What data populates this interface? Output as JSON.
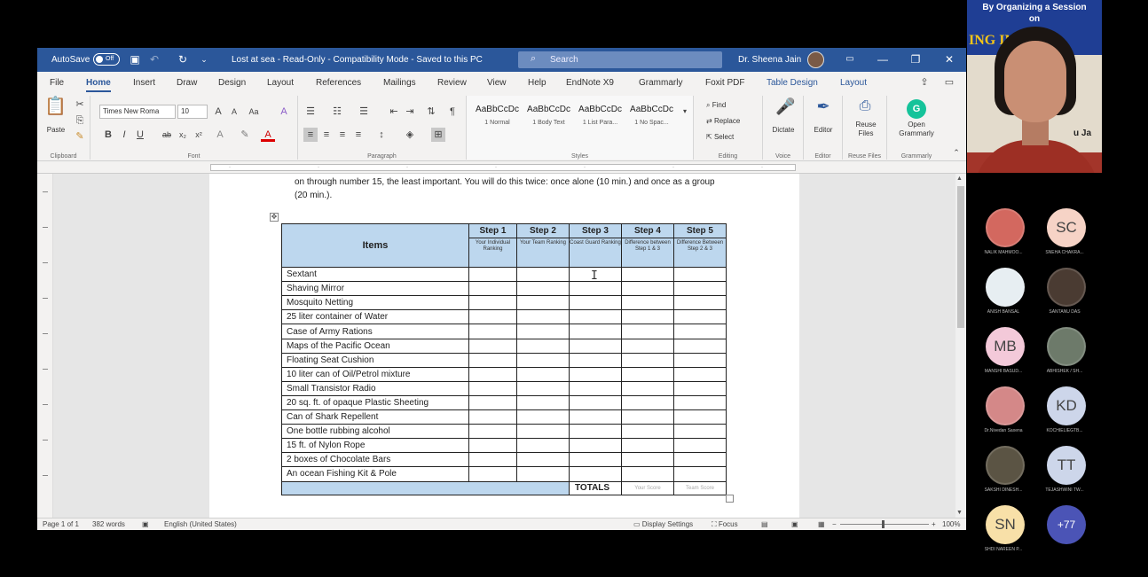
{
  "titlebar": {
    "autosave_label": "AutoSave",
    "autosave_state": "Off",
    "doc_title": "Lost at sea  -  Read-Only  -  Compatibility Mode  -  Saved to this PC",
    "search_placeholder": "Search",
    "user_name": "Dr. Sheena Jain"
  },
  "menu": {
    "items": [
      "File",
      "Home",
      "Insert",
      "Draw",
      "Design",
      "Layout",
      "References",
      "Mailings",
      "Review",
      "View",
      "Help",
      "EndNote X9",
      "Grammarly",
      "Foxit PDF",
      "Table Design",
      "Layout"
    ],
    "active": "Home"
  },
  "ribbon": {
    "paste_label": "Paste",
    "font_name": "Times New Roma",
    "font_size": "10",
    "styles": [
      {
        "preview": "AaBbCcDc",
        "name": "1 Normal"
      },
      {
        "preview": "AaBbCcDc",
        "name": "1 Body Text"
      },
      {
        "preview": "AaBbCcDc",
        "name": "1 List Para..."
      },
      {
        "preview": "AaBbCcDc",
        "name": "1 No Spac..."
      }
    ],
    "find_label": "Find",
    "replace_label": "Replace",
    "select_label": "Select",
    "dictate_label": "Dictate",
    "editor_label": "Editor",
    "reuse_label": "Reuse Files",
    "grammarly_label": "Open Grammarly",
    "groups": [
      "Clipboard",
      "Font",
      "Paragraph",
      "Styles",
      "Editing",
      "Voice",
      "Editor",
      "Reuse Files",
      "Grammarly"
    ]
  },
  "document": {
    "intro_text": "on through number 15, the least important. You will do this twice: once alone (10 min.) and once as a group (20 min.).",
    "table": {
      "items_header": "Items",
      "steps": [
        {
          "title": "Step 1",
          "desc": "Your Individual Ranking"
        },
        {
          "title": "Step 2",
          "desc": "Your Team Ranking"
        },
        {
          "title": "Step 3",
          "desc": "Coast Guard Ranking"
        },
        {
          "title": "Step 4",
          "desc": "Difference between Step 1 & 3"
        },
        {
          "title": "Step 5",
          "desc": "Difference Between Step 2 & 3"
        }
      ],
      "items": [
        "Sextant",
        "Shaving Mirror",
        "Mosquito Netting",
        "25 liter container of Water",
        "Case of Army Rations",
        "Maps of the Pacific Ocean",
        "Floating Seat Cushion",
        "10 liter can of Oil/Petrol mixture",
        "Small Transistor Radio",
        "20 sq. ft. of opaque Plastic Sheeting",
        "Can of Shark Repellent",
        "One bottle rubbing alcohol",
        "15 ft. of Nylon Rope",
        "2 boxes of Chocolate Bars",
        "An ocean Fishing Kit & Pole"
      ],
      "totals_label": "TOTALS",
      "your_score": "Your Score",
      "team_score": "Team Score"
    }
  },
  "statusbar": {
    "page": "Page 1 of 1",
    "words": "382 words",
    "language": "English (United States)",
    "display_settings": "Display Settings",
    "focus": "Focus",
    "zoom": "100%"
  },
  "meeting": {
    "banner_line1": "By Organizing a Session",
    "banner_line2": "on",
    "banner_line3": "ING    ING",
    "speaker_label": "u Ja",
    "participants": [
      {
        "initials": "",
        "name": "NALIK MAHMOO...",
        "color": "#d3685f",
        "photo": true
      },
      {
        "initials": "SC",
        "name": "SNEHA CHAKRA...",
        "color": "#f6d3c6",
        "photo": false
      },
      {
        "initials": "",
        "name": "ANISH BANSAL",
        "color": "#e7eef2",
        "photo": true
      },
      {
        "initials": "",
        "name": "SANTANU DAS",
        "color": "#4a3b32",
        "photo": true
      },
      {
        "initials": "MB",
        "name": "MANSHI BASUD...",
        "color": "#f3c9d9",
        "photo": false
      },
      {
        "initials": "",
        "name": "ABHISHEK / SH...",
        "color": "#6d7a6a",
        "photo": true
      },
      {
        "initials": "",
        "name": "Dr.Nivedan Saxena",
        "color": "#d48888",
        "photo": true
      },
      {
        "initials": "KD",
        "name": "KOCHIELIEGTB...",
        "color": "#cdd6ea",
        "photo": false
      },
      {
        "initials": "",
        "name": "SAKSHI DINESH...",
        "color": "#5b5444",
        "photo": true
      },
      {
        "initials": "TT",
        "name": "TEJASHWINI TW...",
        "color": "#cdd6ea",
        "photo": false
      },
      {
        "initials": "SN",
        "name": "SHDI NAREEN P...",
        "color": "#f8e0a8",
        "photo": false
      },
      {
        "initials": "+77",
        "name": "",
        "color": "#4b54b6",
        "photo": false
      }
    ]
  }
}
